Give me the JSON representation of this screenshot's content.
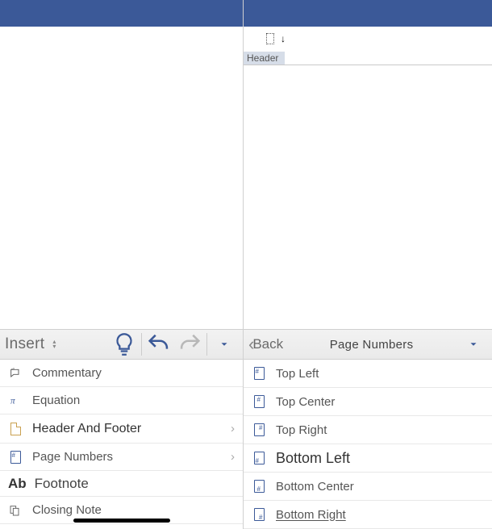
{
  "left": {
    "header_label": "Header",
    "toolbar": {
      "title": "Insert"
    },
    "menu": {
      "commentary": "Commentary",
      "equation": "Equation",
      "header_footer": "Header And Footer",
      "page_numbers": "Page Numbers",
      "footnote_heading": "Footnote",
      "closing_note": "Closing Note"
    }
  },
  "right": {
    "toolbar": {
      "back": "Back",
      "title": "Page Numbers"
    },
    "positions": {
      "top_left": "Top Left",
      "top_center": "Top Center",
      "top_right": "Top Right",
      "bottom_left": "Bottom Left",
      "bottom_center": "Bottom Center",
      "bottom_right": "Bottom Right"
    }
  }
}
